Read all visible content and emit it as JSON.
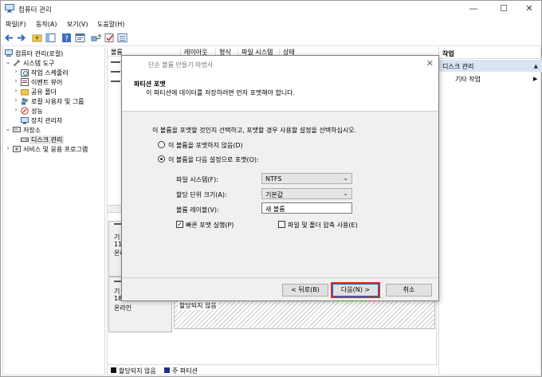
{
  "window": {
    "title": "컴퓨터 관리",
    "minimize": "—",
    "maximize": "☐",
    "close": "✕"
  },
  "menu": [
    "파일(F)",
    "동작(A)",
    "보기(V)",
    "도움말(H)"
  ],
  "toolbar_icons": [
    "back-arrow-icon",
    "forward-arrow-icon",
    "folder-up-icon",
    "console-tree-icon",
    "help-icon",
    "properties-icon",
    "connect-icon",
    "check-icon",
    "list-icon"
  ],
  "tree": {
    "root": "컴퓨터 관리(로컬)",
    "system_tools": "시스템 도구",
    "task_scheduler": "작업 스케줄러",
    "event_viewer": "이벤트 뷰어",
    "shared_folders": "공유 폴더",
    "local_users": "로컬 사용자 및 그룹",
    "performance": "성능",
    "device_manager": "장치 관리자",
    "storage": "저장소",
    "disk_management": "디스크 관리",
    "services": "서비스 및 응용 프로그램"
  },
  "columns": [
    "볼륨",
    "레이아웃",
    "형식",
    "파일 시스템",
    "상태"
  ],
  "disks": [
    {
      "line1": "기",
      "line2": "11",
      "line3": "온라"
    },
    {
      "line1": "기",
      "line2": "18",
      "line3": "온라인"
    }
  ],
  "unallocated_label": "할당되지 않음",
  "legend": [
    {
      "label": "할당되지 않음",
      "color": "#111111"
    },
    {
      "label": "주 파티션",
      "color": "#1e2f8a"
    }
  ],
  "actions": {
    "header": "작업",
    "disk_management": "디스크 관리",
    "more_actions": "기타 작업"
  },
  "dialog": {
    "title": "단순 볼륨 만들기 마법사",
    "close": "✕",
    "heading": "파티션 포맷",
    "subheading": "이 파티션에 데이터를 저장하려면 먼저 포맷해야 합니다.",
    "instruction": "이 볼륨을 포맷할 것인지 선택하고, 포맷할 경우 사용할 설정을 선택하십시오.",
    "radio_no_format": "이 볼륨을 포맷하지 않음(D)",
    "radio_format": "이 볼륨을 다음 설정으로 포맷(O):",
    "fs_label": "파일 시스템(F):",
    "fs_value": "NTFS",
    "alloc_label": "할당 단위 크기(A):",
    "alloc_value": "기본값",
    "volume_label_label": "볼륨 레이블(V):",
    "volume_label_value": "새 볼륨",
    "quick_format": "빠른 포맷 실행(P)",
    "compression": "파일 및 폴더 압축 사용(E)",
    "back": "< 뒤로(B)",
    "next": "다음(N) >",
    "cancel": "취소"
  }
}
